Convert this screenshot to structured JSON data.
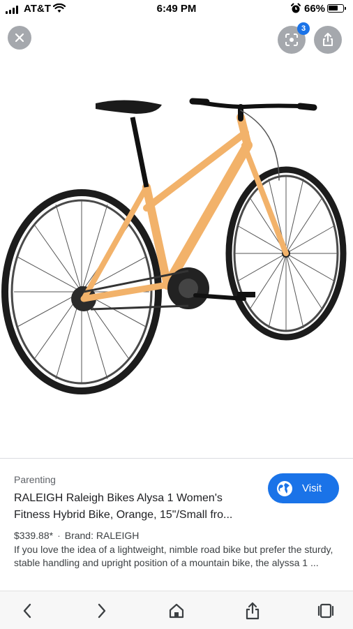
{
  "status_bar": {
    "carrier": "AT&T",
    "time": "6:49 PM",
    "battery_percent": "66%",
    "battery_level": 0.66
  },
  "viewer": {
    "close_icon": "close-icon",
    "lens_icon": "lens-icon",
    "lens_badge": "3",
    "share_icon": "share-icon",
    "image_subject": "orange women's hybrid bicycle"
  },
  "result": {
    "source": "Parenting",
    "title_line1": "RALEIGH Raleigh Bikes Alysa 1 Women's",
    "title_line2": "Fitness Hybrid Bike, Orange, 15\"/Small fro...",
    "visit_label": "Visit",
    "price": "$339.88*",
    "separator": "·",
    "brand": "Brand: RALEIGH",
    "description": "If you love the idea of a lightweight, nimble road bike but prefer the sturdy, stable handling and upright position of a mountain bike, the alyssa 1 ..."
  },
  "toolbar": {
    "items": [
      "back-icon",
      "forward-icon",
      "home-icon",
      "share-icon",
      "tabs-icon"
    ]
  },
  "colors": {
    "accent": "#1a73e8",
    "button_gray": "#a5a8ad",
    "bike_frame": "#f2b26a"
  }
}
